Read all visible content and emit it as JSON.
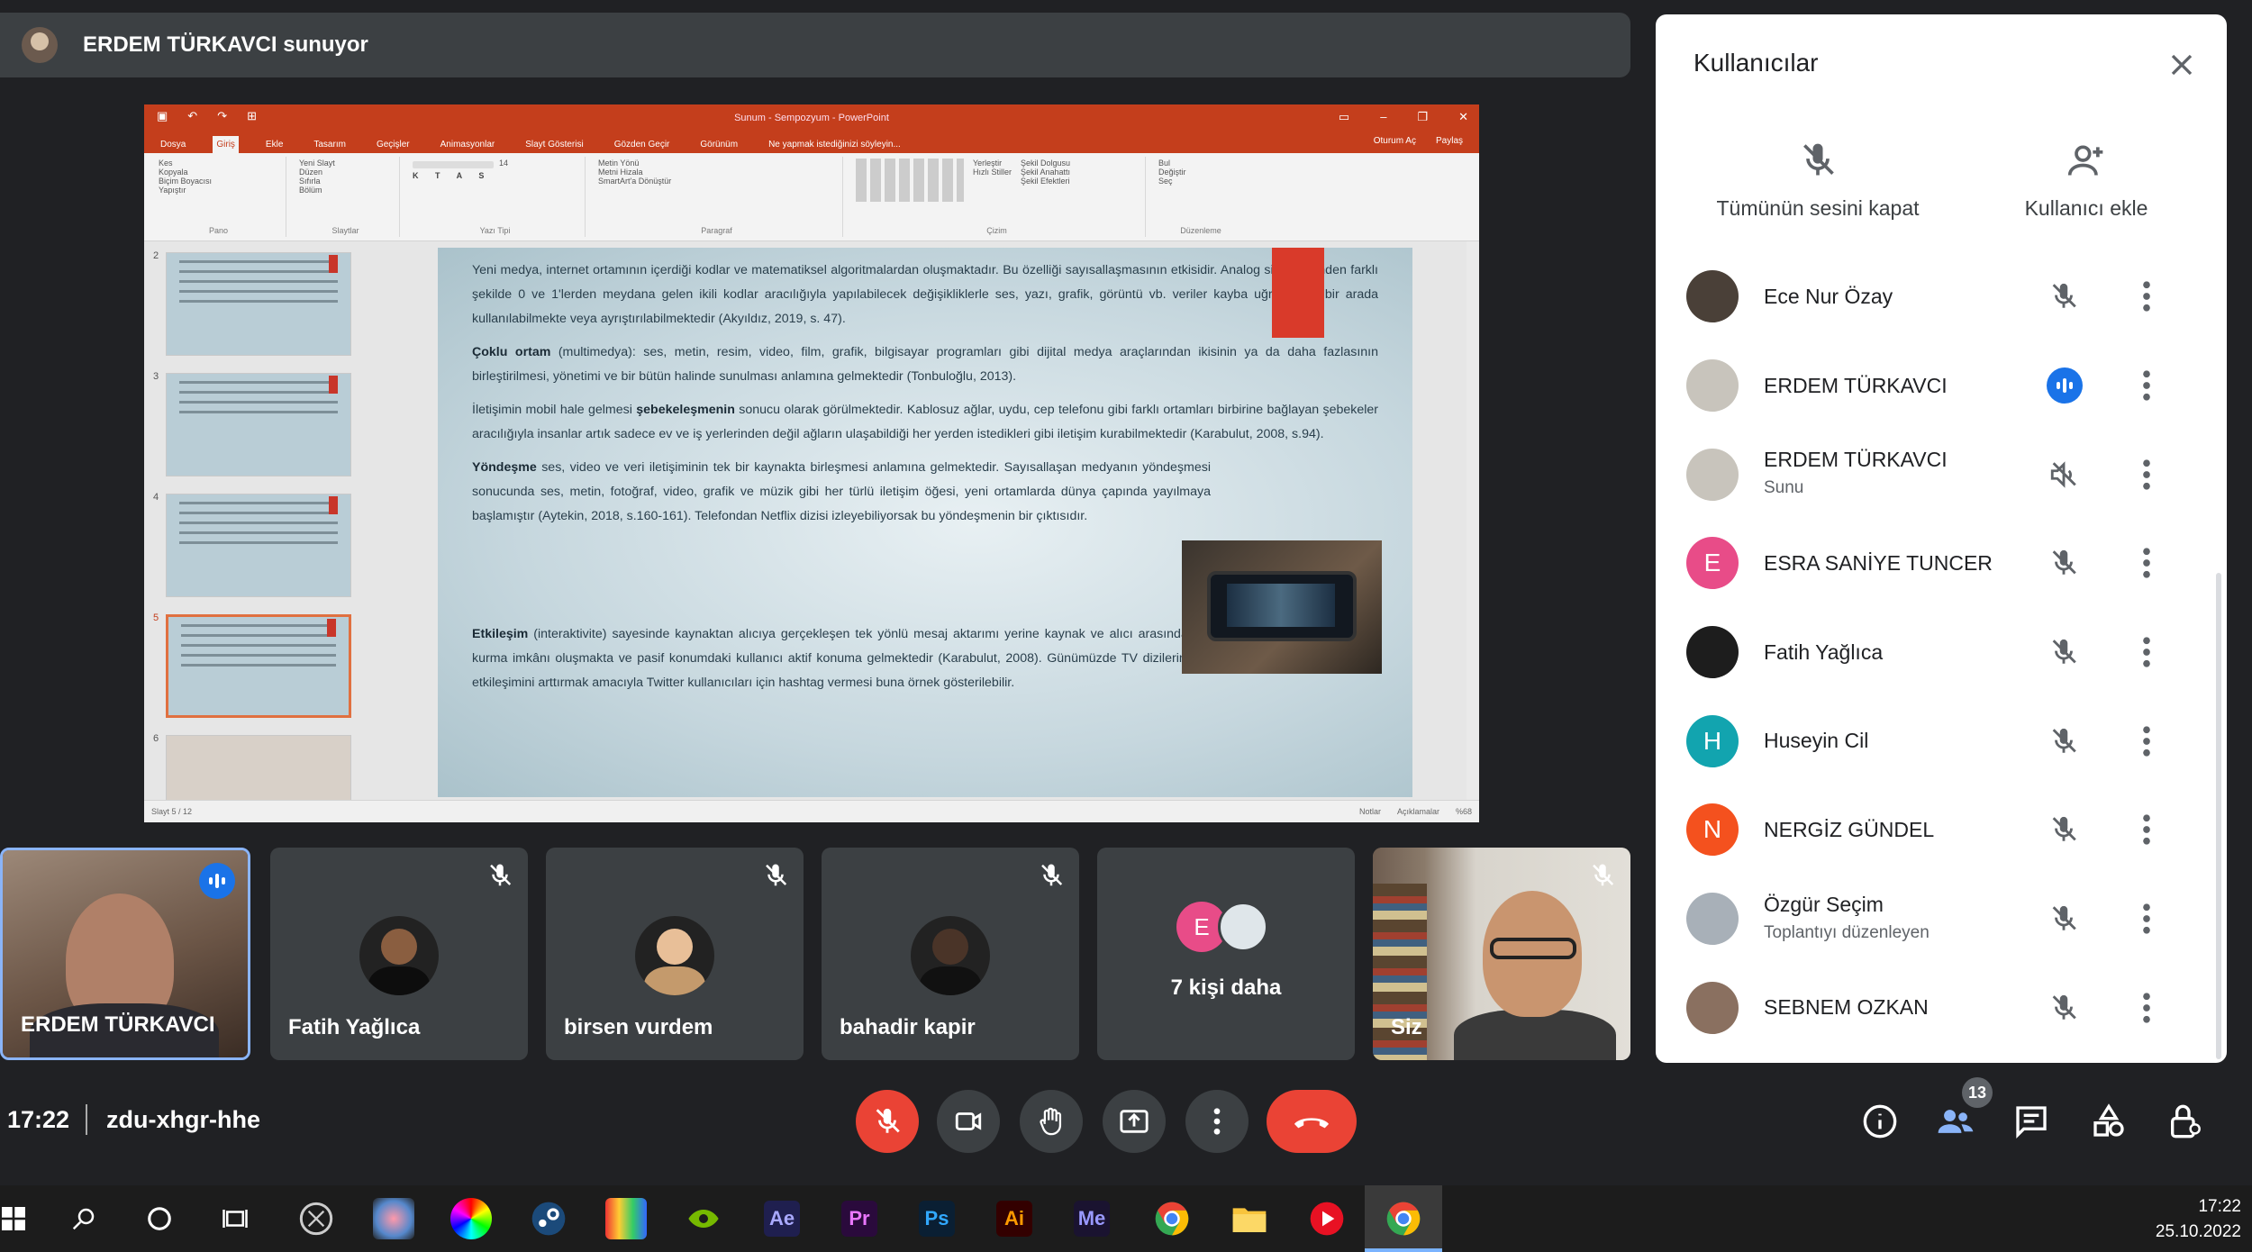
{
  "presenter": {
    "text": "ERDEM TÜRKAVCI sunuyor"
  },
  "powerpoint": {
    "window_title": "Sunum - Sempozyum - PowerPoint",
    "tabs": [
      "Dosya",
      "Giriş",
      "Ekle",
      "Tasarım",
      "Geçişler",
      "Animasyonlar",
      "Slayt Gösterisi",
      "Gözden Geçir",
      "Görünüm",
      "Ne yapmak istediğinizi söyleyin..."
    ],
    "tabs_right": [
      "Oturum Aç",
      "Paylaş"
    ],
    "ribbon_groups": [
      "Pano",
      "Slaytlar",
      "Yazı Tipi",
      "Paragraf",
      "Çizim",
      "Düzenleme"
    ],
    "ribbon_items": {
      "clipboard": [
        "Kes",
        "Kopyala",
        "Biçim Boyacısı",
        "Yapıştır"
      ],
      "slides": [
        "Yeni Slayt",
        "Düzen",
        "Sıfırla",
        "Bölüm"
      ],
      "font_size": "14",
      "paragraph": [
        "Metin Yönü",
        "Metni Hizala",
        "SmartArt'a Dönüştür"
      ],
      "drawing": [
        "Yerleştir",
        "Hızlı Stiller",
        "Şekil Dolgusu",
        "Şekil Anahattı",
        "Şekil Efektleri"
      ],
      "editing": [
        "Bul",
        "Değiştir",
        "Seç"
      ]
    },
    "thumb_numbers": [
      "2",
      "3",
      "4",
      "5",
      "6"
    ],
    "status_left": "Slayt 5 / 12",
    "status_right": [
      "Notlar",
      "Açıklamalar",
      "%68"
    ],
    "slide": {
      "p1": "Yeni medya, internet ortamının içerdiği kodlar ve matematiksel algoritmalardan oluşmaktadır. Bu özelliği sayısallaşmasının etkisidir. Analog sistemlerinden farklı şekilde 0 ve 1'lerden meydana gelen ikili kodlar aracılığıyla yapılabilecek değişikliklerle ses, yazı, grafik, görüntü vb. veriler kayba uğramadan bir arada kullanılabilmekte veya ayrıştırılabilmektedir (Akyıldız, 2019, s. 47).",
      "p2_bold": "Çoklu ortam",
      "p2": " (multimedya): ses, metin, resim, video, film, grafik, bilgisayar programları gibi dijital medya araçlarından ikisinin ya da daha fazlasının birleştirilmesi, yönetimi ve bir bütün halinde sunulması anlamına gelmektedir (Tonbuloğlu, 2013).",
      "p3a": "İletişimin mobil hale gelmesi ",
      "p3_bold": "şebekeleşmenin",
      "p3b": " sonucu olarak görülmektedir. Kablosuz ağlar, uydu, cep telefonu gibi farklı ortamları birbirine bağlayan şebekeler aracılığıyla insanlar artık sadece ev ve iş yerlerinden değil ağların ulaşabildiği her yerden istedikleri gibi iletişim kurabilmektedir (Karabulut, 2008, s.94).",
      "p4_bold": "Yöndeşme",
      "p4": " ses, video ve veri iletişiminin tek bir kaynakta birleşmesi anlamına gelmektedir. Sayısallaşan medyanın yöndeşmesi sonucunda ses, metin, fotoğraf, video, grafik ve müzik gibi her türlü iletişim öğesi, yeni ortamlarda dünya çapında yayılmaya başlamıştır (Aytekin, 2018, s.160-161). Telefondan Netflix dizisi izleyebiliyorsak bu yöndeşmenin bir çıktısıdır.",
      "p5_bold": "Etkileşim",
      "p5": " (interaktivite) sayesinde kaynaktan alıcıya gerçekleşen tek yönlü mesaj aktarımı yerine kaynak ve alıcı arasında karşılıklı veya çok yönlü iletişim kurma imkânı oluşmakta ve pasif konumdaki kullanıcı aktif konuma gelmektedir (Karabulut, 2008). Günümüzde TV dizilerinin yayın saatleri sırasında izleyici etkileşimini arttırmak amacıyla Twitter kullanıcıları için hashtag vermesi buna örnek gösterilebilir."
    }
  },
  "tiles": [
    {
      "name": "ERDEM TÜRKAVCI"
    },
    {
      "name": "Fatih Yağlıca"
    },
    {
      "name": "birsen vurdem"
    },
    {
      "name": "bahadir kapir"
    },
    {
      "name": "7 kişi daha",
      "initial": "E"
    },
    {
      "name": "Siz"
    }
  ],
  "panel": {
    "title": "Kullanıcılar",
    "mute_all": "Tümünün sesini kapat",
    "add_user": "Kullanıcı ekle",
    "people": [
      {
        "name": "Ece Nur Özay",
        "sub": ""
      },
      {
        "name": "ERDEM TÜRKAVCI",
        "sub": ""
      },
      {
        "name": "ERDEM TÜRKAVCI",
        "sub": "Sunu"
      },
      {
        "name": "ESRA SANİYE TUNCER",
        "sub": "",
        "initial": "E"
      },
      {
        "name": "Fatih Yağlıca",
        "sub": ""
      },
      {
        "name": "Huseyin Cil",
        "sub": "",
        "initial": "H"
      },
      {
        "name": "NERGİZ GÜNDEL",
        "sub": "",
        "initial": "N"
      },
      {
        "name": "Özgür Seçim",
        "sub": "Toplantıyı düzenleyen"
      },
      {
        "name": "SEBNEM OZKAN",
        "sub": ""
      }
    ]
  },
  "meeting": {
    "time": "17:22",
    "code": "zdu-xhgr-hhe",
    "people_count": "13"
  },
  "taskbar": {
    "time": "17:22",
    "date": "25.10.2022",
    "app_labels": [
      "Ae",
      "Pr",
      "Ps",
      "Ai",
      "Me"
    ]
  },
  "colors": {
    "accent": "#1a73e8",
    "danger": "#ea4335",
    "ppt": "#c43e1c",
    "avatar_e": "#e84c88",
    "avatar_h": "#12a4af",
    "avatar_n": "#f4511e"
  }
}
